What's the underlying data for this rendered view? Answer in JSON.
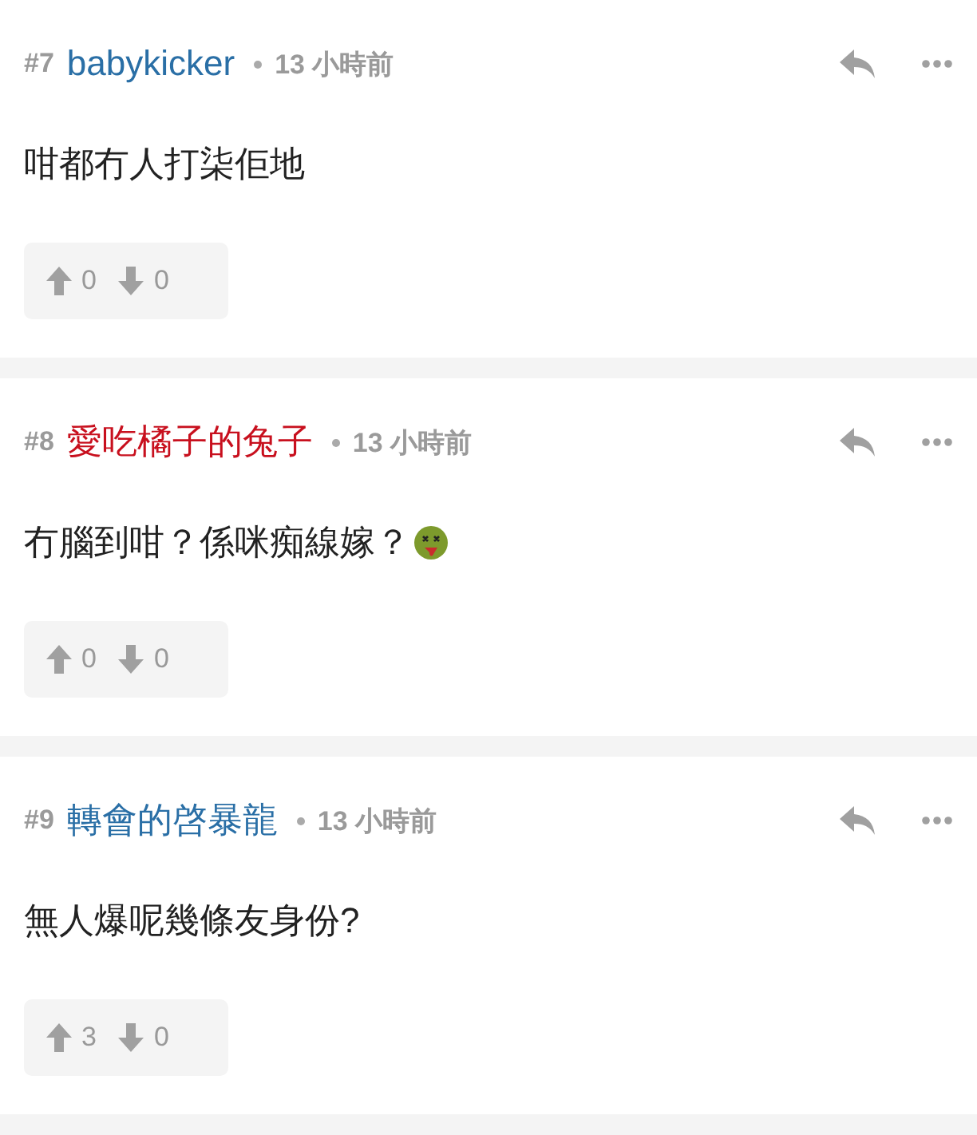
{
  "comments": [
    {
      "number": "#7",
      "user": "babykicker",
      "color": "#2a6fa6",
      "time": "13 小時前",
      "text": "咁都冇人打柒佢地",
      "emoji": false,
      "up": "0",
      "down": "0"
    },
    {
      "number": "#8",
      "user": "愛吃橘子的兔子",
      "color": "#c8101e",
      "time": "13 小時前",
      "text": "冇腦到咁？係咪痴線嫁？",
      "emoji": true,
      "up": "0",
      "down": "0"
    },
    {
      "number": "#9",
      "user": "轉會的啓暴龍",
      "color": "#2a6fa6",
      "time": "13 小時前",
      "text": "無人爆呢幾條友身份?",
      "emoji": false,
      "up": "3",
      "down": "0"
    }
  ]
}
